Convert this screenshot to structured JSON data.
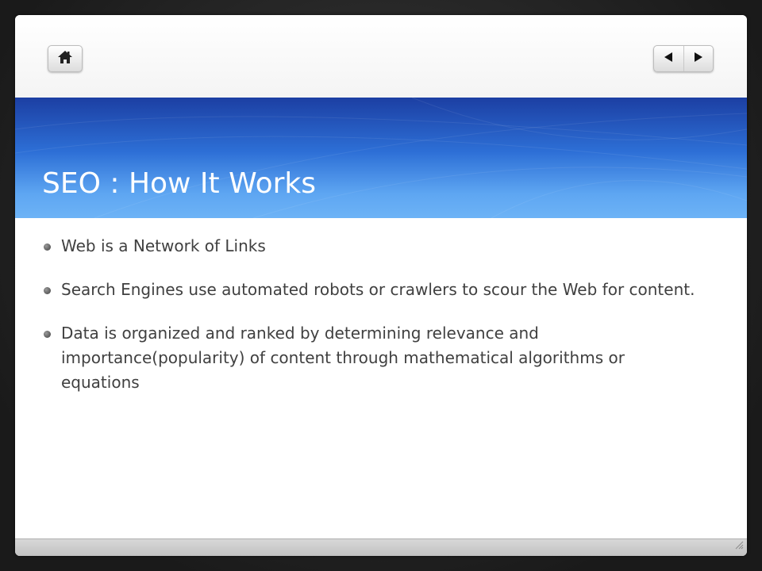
{
  "slide": {
    "title": "SEO : How It Works",
    "bullets": [
      {
        "text": "Web is a Network of Links"
      },
      {
        "text": "Search Engines use automated robots or crawlers to scour the Web for content."
      },
      {
        "text": "Data is organized and ranked by  determining relevance and importance(popularity) of content through mathematical algorithms or equations"
      }
    ]
  },
  "navigation": {
    "home_icon": "home-icon",
    "previous_icon": "triangle-left-icon",
    "next_icon": "triangle-right-icon"
  },
  "colors": {
    "title_band_top": "#1c3fa3",
    "title_band_bottom": "#6db3f6",
    "title_text": "#ffffff",
    "body_text": "#404040"
  }
}
